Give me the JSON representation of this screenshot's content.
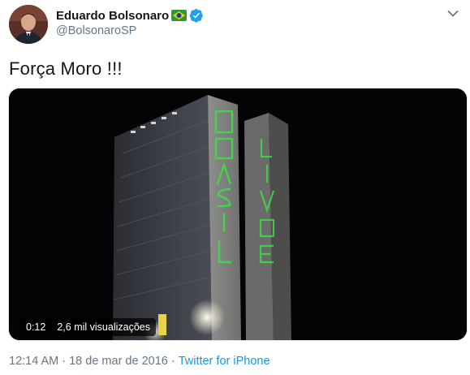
{
  "author": {
    "display_name": "Eduardo Bolsonaro",
    "handle": "@BolsonaroSP"
  },
  "tweet": {
    "text": "Força Moro !!!"
  },
  "video": {
    "duration": "0:12",
    "views": "2,6 mil visualizações",
    "laser_text_left": [
      "B",
      "R",
      "A",
      "S",
      "I",
      "L"
    ],
    "laser_text_right": [
      "L",
      "I",
      "V",
      "R",
      "E"
    ]
  },
  "meta": {
    "time": "12:14 AM",
    "separator1": "·",
    "date": "18 de mar de 2016",
    "separator2": "·",
    "source": "Twitter for iPhone"
  },
  "colors": {
    "accent": "#1b95e0",
    "verified": "#1da1f2",
    "laser": "#3ddc4a"
  },
  "icons": [
    "brazil-flag-icon",
    "verified-badge-icon",
    "chevron-down-icon"
  ]
}
